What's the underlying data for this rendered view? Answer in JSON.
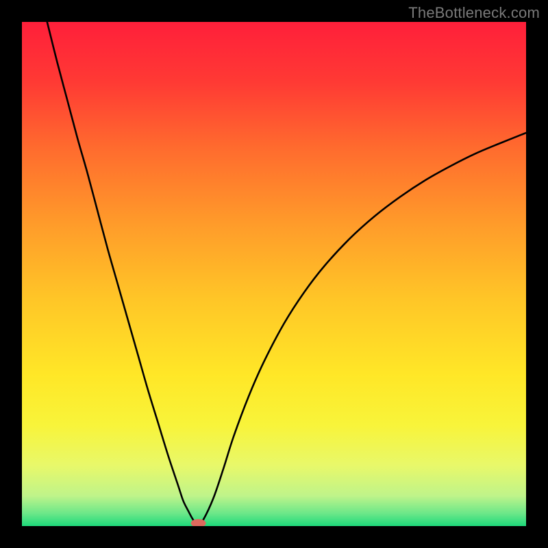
{
  "watermark": "TheBottleneck.com",
  "colors": {
    "frame": "#000000",
    "curve": "#000000",
    "marker": "#dd6a5e",
    "gradient_stops": [
      {
        "offset": 0.0,
        "color": "#ff1f3a"
      },
      {
        "offset": 0.12,
        "color": "#ff3a34"
      },
      {
        "offset": 0.25,
        "color": "#ff6b2e"
      },
      {
        "offset": 0.4,
        "color": "#ff9b2a"
      },
      {
        "offset": 0.55,
        "color": "#ffc627"
      },
      {
        "offset": 0.7,
        "color": "#ffe727"
      },
      {
        "offset": 0.8,
        "color": "#f8f43a"
      },
      {
        "offset": 0.88,
        "color": "#e8f86a"
      },
      {
        "offset": 0.94,
        "color": "#bff48a"
      },
      {
        "offset": 0.975,
        "color": "#6be789"
      },
      {
        "offset": 1.0,
        "color": "#1ed97a"
      }
    ]
  },
  "chart_data": {
    "type": "line",
    "title": "",
    "xlabel": "",
    "ylabel": "",
    "xlim": [
      0,
      100
    ],
    "ylim": [
      0,
      100
    ],
    "grid": false,
    "legend": false,
    "series": [
      {
        "name": "curve",
        "x": [
          5,
          7,
          9,
          11,
          13,
          15,
          17,
          19,
          21,
          23,
          25,
          27,
          29,
          31,
          32,
          33,
          34,
          35,
          36,
          38,
          40,
          42,
          45,
          48,
          52,
          56,
          60,
          65,
          70,
          75,
          80,
          85,
          90,
          95,
          100
        ],
        "y": [
          100,
          92,
          84.5,
          77,
          70,
          62.5,
          55,
          48,
          41,
          34,
          27,
          20.5,
          14,
          8,
          5,
          3,
          1.2,
          0.3,
          1.3,
          5.6,
          11.5,
          17.8,
          25.8,
          32.6,
          40.2,
          46.4,
          51.6,
          57.0,
          61.5,
          65.3,
          68.6,
          71.4,
          73.9,
          76.0,
          78.0
        ]
      }
    ],
    "annotations": [
      {
        "name": "min-marker",
        "x": 35,
        "y": 0.3
      }
    ]
  }
}
